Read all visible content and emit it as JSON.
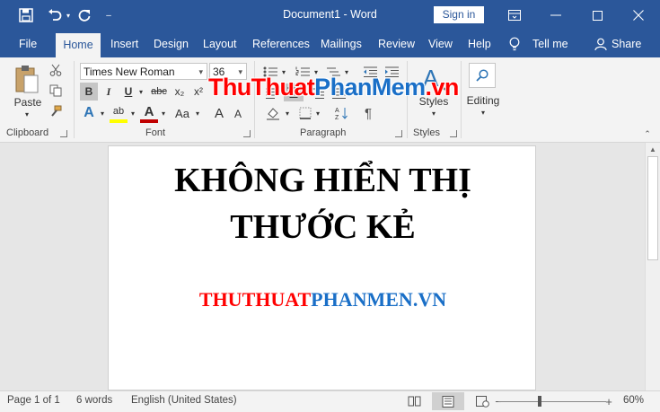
{
  "titlebar": {
    "title": "Document1  -  Word",
    "sign_in_label": "Sign in",
    "quick_access_customize_glyph": "–"
  },
  "tabs": [
    {
      "label": "File",
      "active": false
    },
    {
      "label": "Home",
      "active": true
    },
    {
      "label": "Insert",
      "active": false
    },
    {
      "label": "Design",
      "active": false
    },
    {
      "label": "Layout",
      "active": false
    },
    {
      "label": "References",
      "active": false
    },
    {
      "label": "Mailings",
      "active": false
    },
    {
      "label": "Review",
      "active": false
    },
    {
      "label": "View",
      "active": false
    },
    {
      "label": "Help",
      "active": false
    }
  ],
  "tell_me_label": "Tell me",
  "share_label": "Share",
  "ribbon": {
    "clipboard": {
      "group_label": "Clipboard",
      "paste_label": "Paste"
    },
    "font": {
      "group_label": "Font",
      "font_name": "Times New Roman",
      "font_size": "36",
      "bold": "B",
      "italic": "I",
      "underline": "U",
      "strikethrough": "abc",
      "subscript": "x₂",
      "superscript": "x²",
      "text_effects": "A",
      "highlight": "ab",
      "font_color": "A",
      "change_case": "Aa",
      "grow_font": "A",
      "shrink_font": "A"
    },
    "paragraph": {
      "group_label": "Paragraph",
      "pilcrow": "¶"
    },
    "styles": {
      "group_label": "Styles",
      "styles_label": "Styles"
    },
    "editing": {
      "editing_label": "Editing"
    }
  },
  "watermark": {
    "part1": "ThuThuat",
    "part2": "PhanMem",
    "part3": ".vn"
  },
  "document": {
    "title_line1": "KHÔNG HIỂN THỊ",
    "title_line2": "THƯỚC KẺ",
    "sub_red": "THUTHUAT",
    "sub_blue": "PHANMEN.VN"
  },
  "status": {
    "page": "Page 1 of 1",
    "words": "6 words",
    "language": "English (United States)",
    "zoom": "60%",
    "zoom_percent": 60
  },
  "colors": {
    "word_blue": "#2b579a",
    "red": "#ff0000",
    "blue": "#1a6fc7"
  },
  "icons": {
    "save": "save-icon",
    "undo": "undo-icon",
    "redo": "redo-icon",
    "ribbon_display": "ribbon-display-icon",
    "minimize": "minimize-icon",
    "maximize": "maximize-icon",
    "close": "close-icon",
    "lightbulb": "lightbulb-icon",
    "share": "share-person-icon"
  }
}
